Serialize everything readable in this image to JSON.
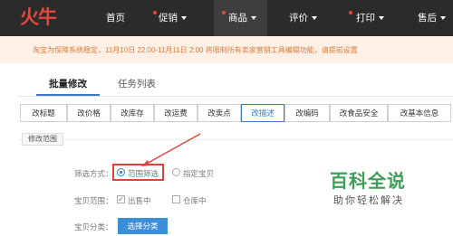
{
  "header": {
    "logo": "火牛",
    "nav": [
      {
        "label": "首页"
      },
      {
        "label": "促销"
      },
      {
        "label": "商品"
      },
      {
        "label": "评价"
      },
      {
        "label": "打印"
      },
      {
        "label": "售后"
      }
    ]
  },
  "notice": "淘宝为保障系统稳定，11月10日 22:00-11月11日 2:00 将限制所有卖家营销工具编辑功能，请提前设置",
  "tabs": [
    {
      "label": "批量修改"
    },
    {
      "label": "任务列表"
    }
  ],
  "sub_tabs": [
    {
      "label": "改标题"
    },
    {
      "label": "改价格"
    },
    {
      "label": "改库存"
    },
    {
      "label": "改运费"
    },
    {
      "label": "改卖点"
    },
    {
      "label": "改描述"
    },
    {
      "label": "改编码"
    },
    {
      "label": "改食品安全"
    },
    {
      "label": "改基本信息"
    }
  ],
  "section_title": "修改范围",
  "form": {
    "filter_label": "筛选方式：",
    "filter_options": [
      {
        "label": "范围筛选",
        "selected": true
      },
      {
        "label": "指定宝贝",
        "selected": false
      }
    ],
    "scope_label": "宝贝范围：",
    "scope_options": [
      {
        "label": "出售中",
        "checked": true
      },
      {
        "label": "仓库中",
        "checked": false
      }
    ],
    "category_label": "宝贝分类：",
    "category_button": "选择分类"
  },
  "checkmark": "✓",
  "watermark": {
    "title": "百科全说",
    "subtitle": "助你轻松解决"
  },
  "colors": {
    "nav_bg": "#2b2b2b",
    "accent_red": "#e8453c",
    "accent_blue": "#3b78c6",
    "button_blue": "#3b8fd9",
    "notice_bg": "#fdf0e6",
    "notice_text": "#e07b39",
    "watermark_green": "#3d9e58"
  }
}
